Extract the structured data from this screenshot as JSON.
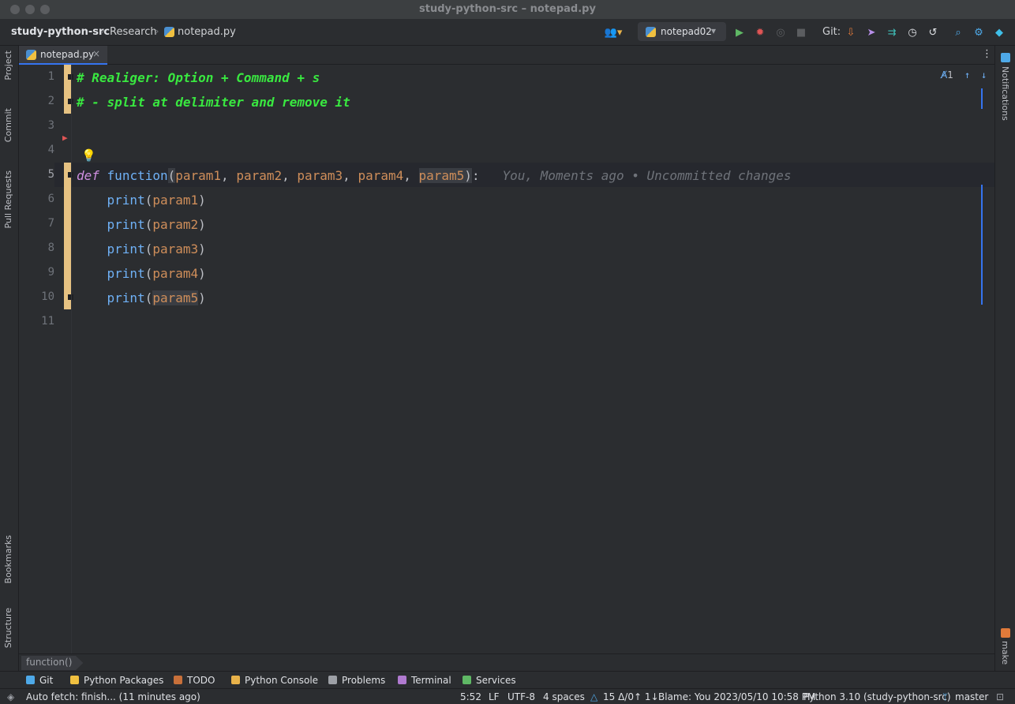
{
  "window": {
    "title": "study-python-src – notepad.py"
  },
  "navbar": {
    "project": "study-python-src",
    "folder": "Research",
    "file": "notepad.py",
    "run_config": "notepad02",
    "git_label": "Git:"
  },
  "left_tools": [
    "Project",
    "Commit",
    "Pull Requests",
    "Bookmarks",
    "Structure"
  ],
  "right_tools": {
    "notifications": "Notifications",
    "make": "make"
  },
  "tab": {
    "label": "notepad.py",
    "close": "×"
  },
  "editor": {
    "lines": [
      "1",
      "2",
      "3",
      "4",
      "5",
      "6",
      "7",
      "8",
      "9",
      "10",
      "11"
    ],
    "comment1": "# Realiger: Option + Command + s",
    "comment2": "# - split at delimiter and remove it",
    "def_kw": "def",
    "fn_name": "function",
    "params": [
      "param1",
      "param2",
      "param3",
      "param4",
      "param5"
    ],
    "print_fn": "print",
    "blame": "You, Moments ago • Uncommitted changes",
    "inspection_count": "1"
  },
  "scope": {
    "label": "function()"
  },
  "tool_windows": [
    "Git",
    "Python Packages",
    "TODO",
    "Python Console",
    "Problems",
    "Terminal",
    "Services"
  ],
  "status": {
    "message": "Auto fetch: finish... (11 minutes ago)",
    "position": "5:52",
    "line_sep": "LF",
    "encoding": "UTF-8",
    "indent": "4 spaces",
    "changes": "15 Δ/0↑ 1↓",
    "blame": "Blame: You 2023/05/10 10:58 PM",
    "interpreter": "Python 3.10 (study-python-src)",
    "branch": "master"
  },
  "colors": {
    "accent": "#3574f0",
    "change_bar": "#e6c282",
    "comment": "#39e840"
  }
}
